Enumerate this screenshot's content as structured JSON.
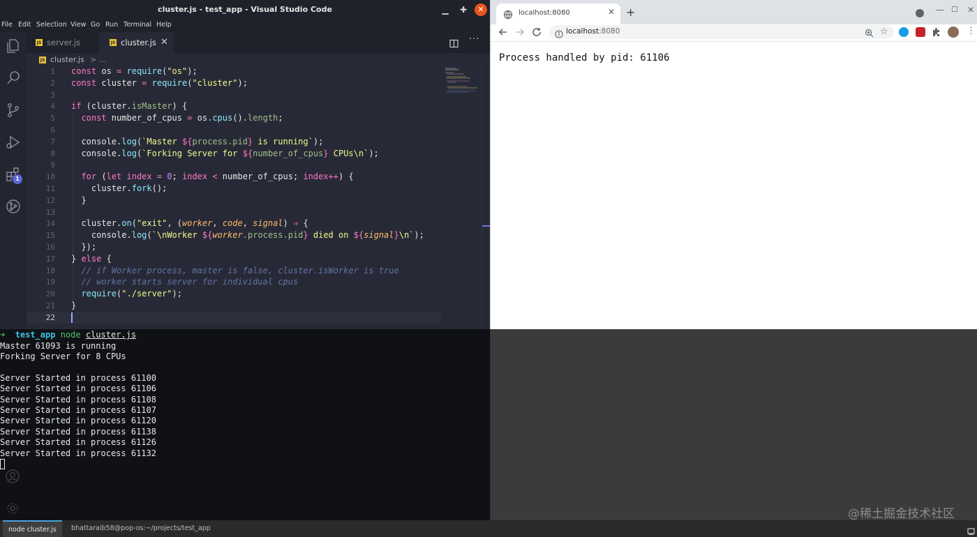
{
  "vscode": {
    "window_title": "cluster.js - test_app - Visual Studio Code",
    "menu": [
      "File",
      "Edit",
      "Selection",
      "View",
      "Go",
      "Run",
      "Terminal",
      "Help"
    ],
    "tabs": [
      {
        "label": "server.js",
        "active": false
      },
      {
        "label": "cluster.js",
        "active": true
      }
    ],
    "tab_close_glyph": "✕",
    "more_glyph": "···",
    "breadcrumb": {
      "file": "cluster.js",
      "separator": "> …"
    },
    "extensions_badge": "1",
    "editor": {
      "active_line": 22,
      "lines": [
        [
          [
            "kw",
            "const"
          ],
          [
            "var",
            " os "
          ],
          [
            "op",
            "="
          ],
          [
            "var",
            " "
          ],
          [
            "fn",
            "require"
          ],
          [
            "punc",
            "("
          ],
          [
            "str",
            "\"os\""
          ],
          [
            "punc",
            ");"
          ]
        ],
        [
          [
            "kw",
            "const"
          ],
          [
            "var",
            " cluster "
          ],
          [
            "op",
            "="
          ],
          [
            "var",
            " "
          ],
          [
            "fn",
            "require"
          ],
          [
            "punc",
            "("
          ],
          [
            "str",
            "\"cluster\""
          ],
          [
            "punc",
            ");"
          ]
        ],
        [],
        [
          [
            "kw",
            "if"
          ],
          [
            "punc",
            " ("
          ],
          [
            "var",
            "cluster"
          ],
          [
            "punc",
            "."
          ],
          [
            "prop",
            "isMaster"
          ],
          [
            "punc",
            ") {"
          ]
        ],
        [
          [
            "var",
            "  "
          ],
          [
            "kw",
            "const"
          ],
          [
            "var",
            " number_of_cpus "
          ],
          [
            "op",
            "="
          ],
          [
            "var",
            " os"
          ],
          [
            "punc",
            "."
          ],
          [
            "fn",
            "cpus"
          ],
          [
            "punc",
            "()."
          ],
          [
            "prop",
            "length"
          ],
          [
            "punc",
            ";"
          ]
        ],
        [],
        [
          [
            "var",
            "  console"
          ],
          [
            "punc",
            "."
          ],
          [
            "fn",
            "log"
          ],
          [
            "punc",
            "("
          ],
          [
            "tpl",
            "`Master "
          ],
          [
            "interp",
            "${"
          ],
          [
            "prop",
            "process.pid"
          ],
          [
            "interp",
            "}"
          ],
          [
            "tpl",
            " is running`"
          ],
          [
            "punc",
            ");"
          ]
        ],
        [
          [
            "var",
            "  console"
          ],
          [
            "punc",
            "."
          ],
          [
            "fn",
            "log"
          ],
          [
            "punc",
            "("
          ],
          [
            "tpl",
            "`Forking Server for "
          ],
          [
            "interp",
            "${"
          ],
          [
            "prop",
            "number_of_cpus"
          ],
          [
            "interp",
            "}"
          ],
          [
            "tpl",
            " CPUs\\n`"
          ],
          [
            "punc",
            ");"
          ]
        ],
        [],
        [
          [
            "var",
            "  "
          ],
          [
            "kw",
            "for"
          ],
          [
            "punc",
            " ("
          ],
          [
            "kw",
            "let"
          ],
          [
            "kw",
            " index"
          ],
          [
            "op",
            " ="
          ],
          [
            "num",
            " 0"
          ],
          [
            "punc",
            "; "
          ],
          [
            "kw",
            "index"
          ],
          [
            "op",
            " <"
          ],
          [
            "var",
            " number_of_cpus"
          ],
          [
            "punc",
            "; "
          ],
          [
            "kw",
            "index"
          ],
          [
            "op",
            "++"
          ],
          [
            "punc",
            ") {"
          ]
        ],
        [
          [
            "var",
            "    cluster"
          ],
          [
            "punc",
            "."
          ],
          [
            "fn",
            "fork"
          ],
          [
            "punc",
            "();"
          ]
        ],
        [
          [
            "punc",
            "  }"
          ]
        ],
        [],
        [
          [
            "var",
            "  cluster"
          ],
          [
            "punc",
            "."
          ],
          [
            "fn",
            "on"
          ],
          [
            "punc",
            "("
          ],
          [
            "str",
            "\"exit\""
          ],
          [
            "punc",
            ", ("
          ],
          [
            "param",
            "worker"
          ],
          [
            "punc",
            ", "
          ],
          [
            "param",
            "code"
          ],
          [
            "punc",
            ", "
          ],
          [
            "param",
            "signal"
          ],
          [
            "punc",
            ") "
          ],
          [
            "op",
            "⇒"
          ],
          [
            "punc",
            " {"
          ]
        ],
        [
          [
            "var",
            "    console"
          ],
          [
            "punc",
            "."
          ],
          [
            "fn",
            "log"
          ],
          [
            "punc",
            "("
          ],
          [
            "tpl",
            "`\\nWorker "
          ],
          [
            "interp",
            "${"
          ],
          [
            "param",
            "worker"
          ],
          [
            "prop",
            ".process.pid"
          ],
          [
            "interp",
            "}"
          ],
          [
            "tpl",
            " died on "
          ],
          [
            "interp",
            "${"
          ],
          [
            "param",
            "signal"
          ],
          [
            "interp",
            "}"
          ],
          [
            "tpl",
            "\\n`"
          ],
          [
            "punc",
            ");"
          ]
        ],
        [
          [
            "punc",
            "  });"
          ]
        ],
        [
          [
            "punc",
            "} "
          ],
          [
            "kw",
            "else"
          ],
          [
            "punc",
            " {"
          ]
        ],
        [
          [
            "cmt",
            "  // if Worker process, master is false, cluster.isWorker is true"
          ]
        ],
        [
          [
            "cmt",
            "  // worker starts server for individual cpus"
          ]
        ],
        [
          [
            "var",
            "  "
          ],
          [
            "fn",
            "require"
          ],
          [
            "punc",
            "("
          ],
          [
            "str",
            "\"./server\""
          ],
          [
            "punc",
            ");"
          ]
        ],
        [
          [
            "punc",
            "}"
          ]
        ],
        []
      ]
    }
  },
  "terminal": {
    "prompt_arrow": "➜",
    "prompt_dir": "test_app",
    "prompt_cmd": "node",
    "prompt_arg": "cluster.js",
    "output": [
      "Master 61093 is running",
      "Forking Server for 8 CPUs",
      "",
      "Server Started in process 61100",
      "Server Started in process 61106",
      "Server Started in process 61108",
      "Server Started in process 61107",
      "Server Started in process 61120",
      "Server Started in process 61138",
      "Server Started in process 61126",
      "Server Started in process 61132"
    ]
  },
  "browser": {
    "tab_title": "localhost:8080",
    "tab_close_glyph": "✕",
    "new_tab_glyph": "+",
    "url_host": "localhost",
    "url_port": ":8080",
    "page_text": "Process handled by pid: 61106",
    "window_controls": {
      "minimize": "—",
      "maximize": "☐",
      "close": "✕"
    },
    "star_glyph": "☆",
    "menu_glyph": "⋮"
  },
  "watermark": "@稀土掘金技术社区",
  "taskbar": {
    "items": [
      "node cluster.js",
      "bhattaraib58@pop-os:~/projects/test_app"
    ]
  },
  "colors": {
    "editor_bg": "#272a36",
    "terminal_bg": "#0f1114",
    "panel_bg": "#3b3b3b",
    "close_button": "#e95420",
    "accent": "#5a67d8"
  }
}
